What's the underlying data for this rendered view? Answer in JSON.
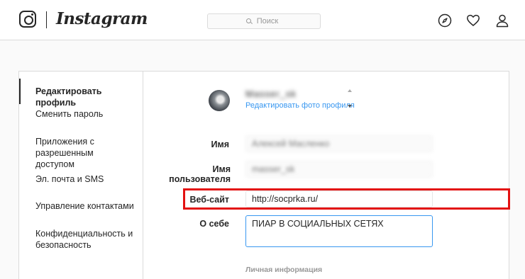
{
  "header": {
    "brand": "Instagram",
    "search_placeholder": "Поиск",
    "icons": [
      "instagram-icon",
      "search-icon",
      "explore-icon",
      "heart-icon",
      "profile-icon"
    ]
  },
  "sidebar": {
    "items": [
      {
        "label": "Редактировать профиль",
        "active": true
      },
      {
        "label": "Сменить пароль"
      },
      {
        "label": "Приложения с разрешенным доступом"
      },
      {
        "label": "Эл. почта и SMS"
      },
      {
        "label": "Управление контактами"
      },
      {
        "label": "Конфиденциальность и безопасность"
      }
    ]
  },
  "profile": {
    "username": "Masser_sk",
    "edit_photo_label": "Редактировать фото профиля"
  },
  "form": {
    "name_label": "Имя",
    "name_value": "Алексей Масленко",
    "username_label": "Имя пользователя",
    "username_value": "masser_sk",
    "website_label": "Веб-сайт",
    "website_value": "http://socprka.ru/",
    "bio_label": "О себе",
    "bio_value": "ПИАР В СОЦИАЛЬНЫХ СЕТЯХ",
    "personal_info_heading": "Личная информация"
  },
  "colors": {
    "link": "#3897f0",
    "highlight": "#e31111",
    "border": "#dbdbdb"
  }
}
